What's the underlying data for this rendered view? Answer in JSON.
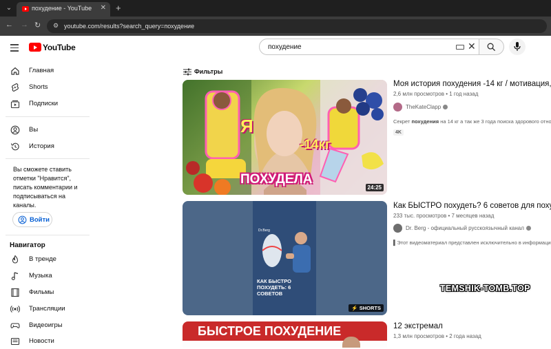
{
  "browser": {
    "tab_title": "похудение - YouTube",
    "url": "youtube.com/results?search_query=похудение",
    "close_glyph": "✕",
    "new_tab_glyph": "+"
  },
  "header": {
    "logo_text": "YouTube",
    "search_value": "похудение"
  },
  "sidebar": {
    "main_items": [
      {
        "label": "Главная",
        "icon": "home-icon"
      },
      {
        "label": "Shorts",
        "icon": "shorts-icon"
      },
      {
        "label": "Подписки",
        "icon": "subscriptions-icon"
      }
    ],
    "you_items": [
      {
        "label": "Вы",
        "icon": "you-icon"
      },
      {
        "label": "История",
        "icon": "history-icon"
      }
    ],
    "signin_prompt": "Вы сможете ставить отметки \"Нравится\", писать комментарии и подписываться на каналы.",
    "login_label": "Войти",
    "navigator_title": "Навигатор",
    "navigator_items": [
      {
        "label": "В тренде",
        "icon": "trending-icon"
      },
      {
        "label": "Музыка",
        "icon": "music-icon"
      },
      {
        "label": "Фильмы",
        "icon": "movies-icon"
      },
      {
        "label": "Трансляции",
        "icon": "live-icon"
      },
      {
        "label": "Видеоигры",
        "icon": "gaming-icon"
      },
      {
        "label": "Новости",
        "icon": "news-icon"
      }
    ]
  },
  "filters_label": "Фильтры",
  "videos": [
    {
      "title": "Моя история похудения -14 кг / мотивация, оп",
      "meta": "2,6 млн просмотров • 1 год назад",
      "channel": "TheKateClapp",
      "desc_pre": "Секрет ",
      "desc_bold": "похудения",
      "desc_post": " на 14 кг а так же 3 года поиска здорового отнош",
      "badge": "4K",
      "duration": "24:25",
      "thumb_text_1": "Я",
      "thumb_text_2": "-14кг",
      "thumb_text_3": "ПОХУДЕЛА"
    },
    {
      "title": "Как БЫСТРО похудеть? 6 советов для похуде",
      "meta": "233 тыс. просмотров • 7 месяцев назад",
      "channel": "Dr. Berg - официальный русскоязычный канал",
      "desc": "Этот видеоматериал представлен исключительно в информацион",
      "shorts_label": "SHORTS",
      "thumb_brand": "Dr.Berg",
      "thumb_caption": "КАК БЫСТРО ПОХУДЕТЬ: 6 СОВЕТОВ"
    },
    {
      "title": "12 экстремал",
      "meta": "1,3 млн просмотров • 2 года назад",
      "thumb_banner": "БЫСТРОЕ ПОХУДЕНИЕ"
    }
  ],
  "watermark": "TEMSHIK-TOMB.TOP",
  "colors": {
    "youtube_red": "#ff0000",
    "link_blue": "#065fd4",
    "chrome_dark": "#1f1f1f"
  }
}
